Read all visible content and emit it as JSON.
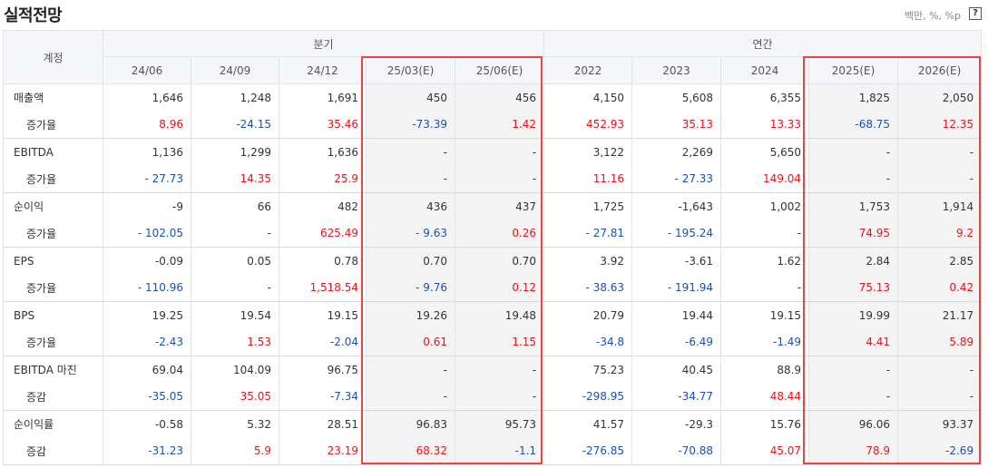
{
  "title": "실적전망",
  "unit": "백만, %, %p",
  "help": "?",
  "header": {
    "account": "계정",
    "quarterly": "분기",
    "annual": "연간",
    "periods": [
      "24/06",
      "24/09",
      "24/12",
      "25/03(E)",
      "25/06(E)",
      "2022",
      "2023",
      "2024",
      "2025(E)",
      "2026(E)"
    ]
  },
  "rows": [
    {
      "label": "매출액",
      "values": [
        "1,646",
        "1,248",
        "1,691",
        "450",
        "456",
        "4,150",
        "5,608",
        "6,355",
        "1,825",
        "2,050"
      ]
    },
    {
      "label": "증가율",
      "values": [
        "8.96",
        "-24.15",
        "35.46",
        "-73.39",
        "1.42",
        "452.93",
        "35.13",
        "13.33",
        "-68.75",
        "12.35"
      ]
    },
    {
      "label": "EBITDA",
      "values": [
        "1,136",
        "1,299",
        "1,636",
        "-",
        "-",
        "3,122",
        "2,269",
        "5,650",
        "-",
        "-"
      ]
    },
    {
      "label": "증가율",
      "values": [
        "- 27.73",
        "14.35",
        "25.9",
        "-",
        "-",
        "11.16",
        "- 27.33",
        "149.04",
        "-",
        "-"
      ]
    },
    {
      "label": "순이익",
      "values": [
        "-9",
        "66",
        "482",
        "436",
        "437",
        "1,725",
        "-1,643",
        "1,002",
        "1,753",
        "1,914"
      ]
    },
    {
      "label": "증가율",
      "values": [
        "- 102.05",
        "-",
        "625.49",
        "- 9.63",
        "0.26",
        "- 27.81",
        "- 195.24",
        "-",
        "74.95",
        "9.2"
      ]
    },
    {
      "label": "EPS",
      "values": [
        "-0.09",
        "0.05",
        "0.78",
        "0.70",
        "0.70",
        "3.92",
        "-3.61",
        "1.62",
        "2.84",
        "2.85"
      ]
    },
    {
      "label": "증가율",
      "values": [
        "- 110.96",
        "-",
        "1,518.54",
        "- 9.76",
        "0.12",
        "- 38.63",
        "- 191.94",
        "-",
        "75.13",
        "0.42"
      ]
    },
    {
      "label": "BPS",
      "values": [
        "19.25",
        "19.54",
        "19.15",
        "19.26",
        "19.48",
        "20.79",
        "19.44",
        "19.15",
        "19.99",
        "21.17"
      ]
    },
    {
      "label": "증가율",
      "values": [
        "-2.43",
        "1.53",
        "-2.04",
        "0.61",
        "1.15",
        "-34.8",
        "-6.49",
        "-1.49",
        "4.41",
        "5.89"
      ]
    },
    {
      "label": "EBITDA 마진",
      "values": [
        "69.04",
        "104.09",
        "96.75",
        "-",
        "-",
        "75.23",
        "40.45",
        "88.9",
        "-",
        "-"
      ]
    },
    {
      "label": "증감",
      "values": [
        "-35.05",
        "35.05",
        "-7.34",
        "-",
        "-",
        "-298.95",
        "-34.77",
        "48.44",
        "-",
        "-"
      ]
    },
    {
      "label": "순이익률",
      "values": [
        "-0.58",
        "5.32",
        "28.51",
        "96.83",
        "95.73",
        "41.57",
        "-29.3",
        "15.76",
        "96.06",
        "93.37"
      ]
    },
    {
      "label": "증감",
      "values": [
        "-31.23",
        "5.9",
        "23.19",
        "68.32",
        "-1.1",
        "-276.85",
        "-70.88",
        "45.07",
        "78.9",
        "-2.69"
      ]
    }
  ],
  "colors": {
    "positive": "#e8131a",
    "negative": "#1b4fb8",
    "highlight": "#e64646"
  }
}
